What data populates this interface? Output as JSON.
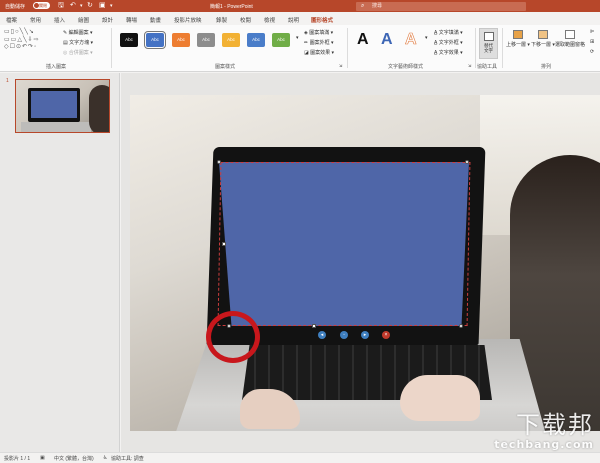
{
  "titlebar": {
    "autosave_label": "自動儲存",
    "autosave_toggle": "關閉",
    "document_title": "簡報1 - PowerPoint",
    "search_placeholder": "搜尋"
  },
  "tabs": [
    "檔案",
    "常用",
    "插入",
    "繪圖",
    "設計",
    "轉場",
    "動畫",
    "投影片放映",
    "錄製",
    "校閱",
    "檢視",
    "說明",
    "圖形格式"
  ],
  "active_tab": "圖形格式",
  "ribbon": {
    "insert_shapes": {
      "label": "插入圖案",
      "edit_shape": "編輯圖案",
      "text_box": "文字方塊",
      "merge_shapes": "合併圖案"
    },
    "shape_styles": {
      "label": "圖案樣式",
      "preset_text": "Abc",
      "fill": "圖案填滿",
      "outline": "圖案外框",
      "effects": "圖案效果",
      "preset_colors": [
        "#111111",
        "#4472c4",
        "#ed7d31",
        "#8d8d8d",
        "#f2b134",
        "#4a7dc9",
        "#70ad47"
      ],
      "selected_index": 1
    },
    "wordart_styles": {
      "label": "文字藝術師樣式",
      "glyph": "A",
      "text_fill": "文字填滿",
      "text_outline": "文字外框",
      "text_effects": "文字效果"
    },
    "accessibility": {
      "label": "協助工具",
      "alt_text_line1": "替代",
      "alt_text_line2": "文字"
    },
    "arrange": {
      "label": "排列",
      "bring_forward": "上移一層",
      "send_backward": "下移一層",
      "selection_pane": "選取範圍窗格"
    }
  },
  "slides_pane": {
    "slide_number": "1"
  },
  "statusbar": {
    "slide_info": "投影片 1 / 1",
    "language": "中文 (繁體，台灣)",
    "accessibility": "協助工具: 調查"
  },
  "watermark": {
    "big": "下载邦",
    "small": "techbang.com"
  }
}
